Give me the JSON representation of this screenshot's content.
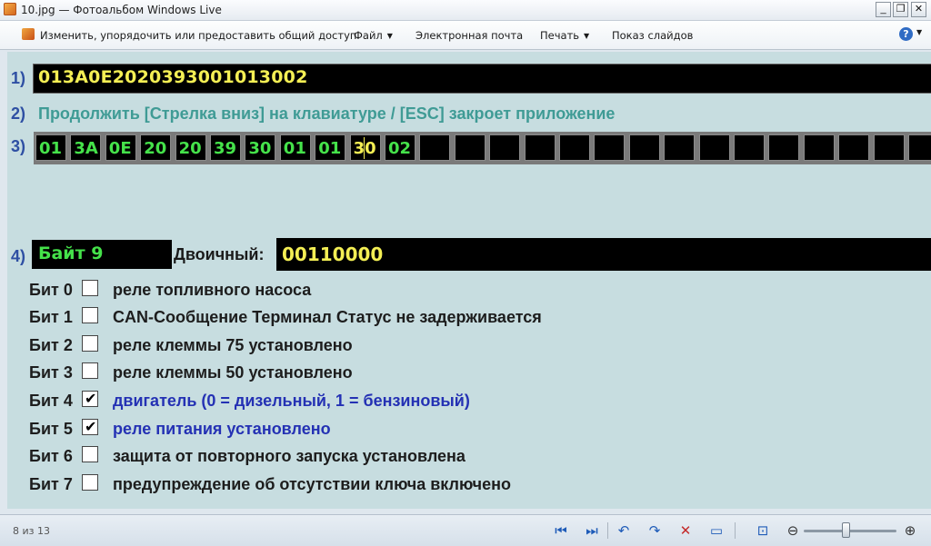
{
  "window": {
    "title": "10.jpg — Фотоальбом Windows Live",
    "controls": [
      "_",
      "❐",
      "✕"
    ]
  },
  "toolbar": {
    "edit_label": "Изменить, упорядочить или предоставить общий доступ",
    "file_label": "Файл",
    "email_label": "Электронная почта",
    "print_label": "Печать",
    "slideshow_label": "Показ слайдов",
    "help_glyph": "?"
  },
  "photo": {
    "row1": {
      "num": "1)",
      "value": "013A0E2020393001013002"
    },
    "row2": {
      "num": "2)",
      "text": "Продолжить [Стрелка вниз] на клавиатуре / [ESC] закроет приложение"
    },
    "row3": {
      "num": "3)",
      "bytes": [
        "01",
        "3A",
        "0E",
        "20",
        "20",
        "39",
        "30",
        "01",
        "01",
        "30",
        "02",
        "",
        "",
        "",
        "",
        "",
        "",
        "",
        "",
        "",
        "",
        "",
        "",
        "",
        "",
        ""
      ]
    },
    "row4": {
      "num": "4)",
      "byte_label": "Байт 9",
      "binary_label": "Двоичный:",
      "binary_value": "00110000"
    },
    "bits": [
      {
        "label": "Бит 0",
        "checked": false,
        "text": "реле топливного насоса"
      },
      {
        "label": "Бит 1",
        "checked": false,
        "text": "CAN-Сообщение Терминал Статус не задерживается"
      },
      {
        "label": "Бит 2",
        "checked": false,
        "text": "реле клеммы 75 установлено"
      },
      {
        "label": "Бит 3",
        "checked": false,
        "text": "реле клеммы 50 установлено"
      },
      {
        "label": "Бит 4",
        "checked": true,
        "text": "двигатель (0 = дизельный, 1 = бензиновый)"
      },
      {
        "label": "Бит 5",
        "checked": true,
        "text": "реле питания установлено"
      },
      {
        "label": "Бит 6",
        "checked": false,
        "text": "защита от повторного запуска установлена"
      },
      {
        "label": "Бит 7",
        "checked": false,
        "text": "предупреждение об отсутствии ключа включено"
      }
    ]
  },
  "statusbar": {
    "count": "8 из 13",
    "zoom_level_fraction": 0.45
  },
  "colors": {
    "lcd_yellow": "#f4ef54",
    "lcd_green": "#45e24a",
    "checked_text": "#2431b4",
    "hint_text": "#3f9b95"
  }
}
